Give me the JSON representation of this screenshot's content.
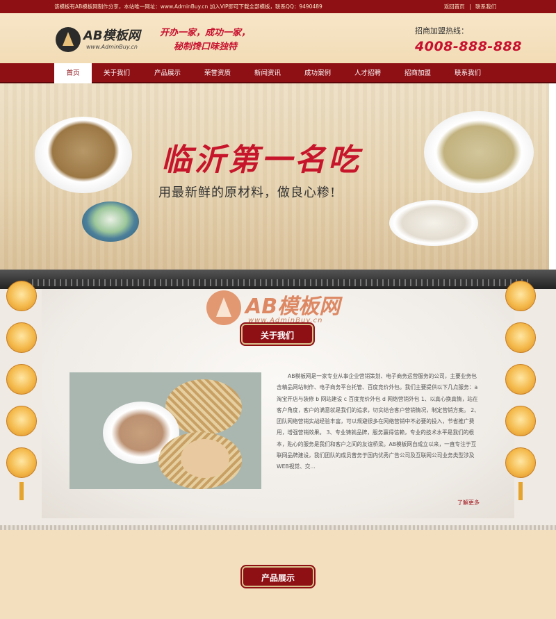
{
  "topbar": {
    "notice": "该模板有AB模板网制作分享，本站唯一网址：www.AdminBuy.cn 加入VIP即可下载全部模板，联系QQ：9490489",
    "links": [
      "返回首页",
      "|",
      "联系我们"
    ]
  },
  "header": {
    "logo": {
      "name": "AB模板网",
      "url": "www.AdminBuy.cn"
    },
    "slogan": [
      "开办一家，成功一家，",
      "秘制馋口味独特"
    ],
    "hotline_label": "招商加盟热线：",
    "hotline_phone": "4008-888-888"
  },
  "nav": {
    "items": [
      "首页",
      "关于我们",
      "产品展示",
      "荣誉资质",
      "新闻资讯",
      "成功案例",
      "人才招聘",
      "招商加盟",
      "联系我们"
    ],
    "active_index": 0
  },
  "banner": {
    "title": "临沂第一名吃",
    "subtitle": "用最新鲜的原材料，做良心糁!"
  },
  "about": {
    "watermark_name": "AB模板网",
    "watermark_url": "www.AdminBuy.cn",
    "section_title": "关于我们",
    "text": "AB模板网是一家专业从事企业营销策划、电子商务运营服务的公司，主要业务包含精品网站制作、电子商务平台托管、百度竞价外包。我们主要提供以下几点服务：a 淘宝开店与装修 b 网站建设 c 百度竞价外包 d 网络营销外包 1、以真心换真情，站在客户角度，客户的满意就是我们的追求，切实结合客户营销情况，制定营销方案。 2、团队网络营销实战经验丰富，可以规避很多在网络营销中不必要的投入，节省推广费用，增强营销效果。 3、专业铸就品牌，服务赢得信赖，专业的技术水平是我们的根本，贴心的服务是我们和客户之间的友谊桥梁。AB模板网自成立以来，一直专注于互联网品牌建设，我们团队的成员曾务于国内优秀广告公司及互联网公司业务类型涉及WEB视觉、交...",
    "more": "了解更多"
  },
  "product": {
    "section_title": "产品展示"
  },
  "colors": {
    "brand_red": "#8e0f14",
    "accent_red": "#c8102e",
    "page_bg": "#f3dfbd"
  }
}
